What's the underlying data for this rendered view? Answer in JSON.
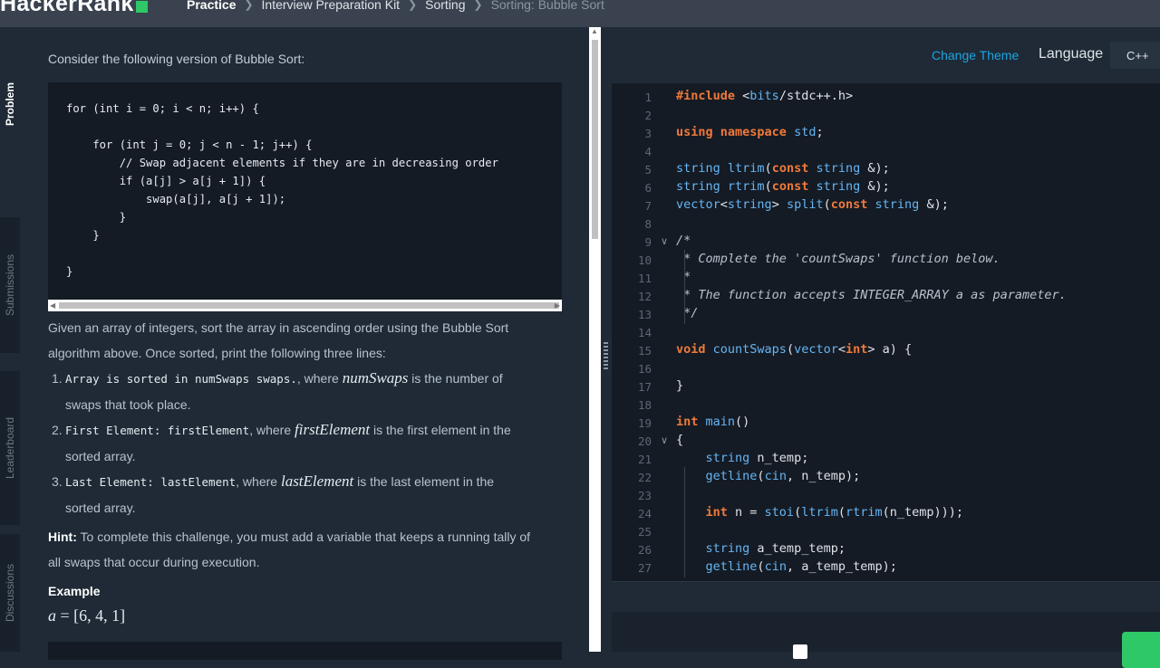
{
  "topbar": {
    "logo_text": "HackerRank",
    "breadcrumbs": [
      "Practice",
      "Interview Preparation Kit",
      "Sorting",
      "Sorting: Bubble Sort"
    ]
  },
  "sidetabs": [
    "Problem",
    "Submissions",
    "Leaderboard",
    "Discussions"
  ],
  "problem": {
    "intro": "Consider the following version of Bubble Sort:",
    "code_lines": [
      "for (int i = 0; i < n; i++) {",
      "",
      "    for (int j = 0; j < n - 1; j++) {",
      "        // Swap adjacent elements if they are in decreasing order",
      "        if (a[j] > a[j + 1]) {",
      "            swap(a[j], a[j + 1]);",
      "        }",
      "    }",
      "",
      "}"
    ],
    "para1_line1": "Given an array of integers, sort the array in ascending order using the Bubble Sort",
    "para1_line2": "algorithm above. Once sorted, print the following three lines:",
    "items": [
      {
        "num": "1.",
        "code": "Array is sorted in numSwaps swaps.",
        "mid": ", where ",
        "var": "numSwaps",
        "rest1": " is the number of",
        "rest2": "swaps that took place."
      },
      {
        "num": "2.",
        "code": "First Element: firstElement",
        "mid": ", where ",
        "var": "firstElement",
        "rest1": " is the first element in the",
        "rest2": "sorted array."
      },
      {
        "num": "3.",
        "code": "Last Element: lastElement",
        "mid": ", where ",
        "var": "lastElement",
        "rest1": " is the last element in the",
        "rest2": "sorted array."
      }
    ],
    "hint_label": "Hint:",
    "hint_line1": " To complete this challenge, you must add a variable that keeps a running tally of",
    "hint_line2": "all swaps that occur during execution.",
    "example_heading": "Example",
    "example_var": "a",
    "example_eq": " = [6, 4, 1]"
  },
  "editor": {
    "change_theme": "Change Theme",
    "language_label": "Language",
    "language_value": "C++",
    "lines": [
      {
        "n": "1",
        "t": "#include <bits/stdc++.h>"
      },
      {
        "n": "2",
        "t": ""
      },
      {
        "n": "3",
        "t": "using namespace std;"
      },
      {
        "n": "4",
        "t": ""
      },
      {
        "n": "5",
        "t": "string ltrim(const string &);"
      },
      {
        "n": "6",
        "t": "string rtrim(const string &);"
      },
      {
        "n": "7",
        "t": "vector<string> split(const string &);"
      },
      {
        "n": "8",
        "t": ""
      },
      {
        "n": "9",
        "t": "/*"
      },
      {
        "n": "10",
        "t": " * Complete the 'countSwaps' function below."
      },
      {
        "n": "11",
        "t": " *"
      },
      {
        "n": "12",
        "t": " * The function accepts INTEGER_ARRAY a as parameter."
      },
      {
        "n": "13",
        "t": " */"
      },
      {
        "n": "14",
        "t": ""
      },
      {
        "n": "15",
        "t": "void countSwaps(vector<int> a) {"
      },
      {
        "n": "16",
        "t": ""
      },
      {
        "n": "17",
        "t": "}"
      },
      {
        "n": "18",
        "t": ""
      },
      {
        "n": "19",
        "t": "int main()"
      },
      {
        "n": "20",
        "t": "{"
      },
      {
        "n": "21",
        "t": "    string n_temp;"
      },
      {
        "n": "22",
        "t": "    getline(cin, n_temp);"
      },
      {
        "n": "23",
        "t": ""
      },
      {
        "n": "24",
        "t": "    int n = stoi(ltrim(rtrim(n_temp)));"
      },
      {
        "n": "25",
        "t": ""
      },
      {
        "n": "26",
        "t": "    string a_temp_temp;"
      },
      {
        "n": "27",
        "t": "    getline(cin, a_temp_temp);"
      }
    ]
  },
  "colors": {
    "keyword": "#f0793a",
    "function": "#66b5f4",
    "comment": "#b8c2cc",
    "accent": "#1ba4e0",
    "brand": "#2ec866"
  }
}
